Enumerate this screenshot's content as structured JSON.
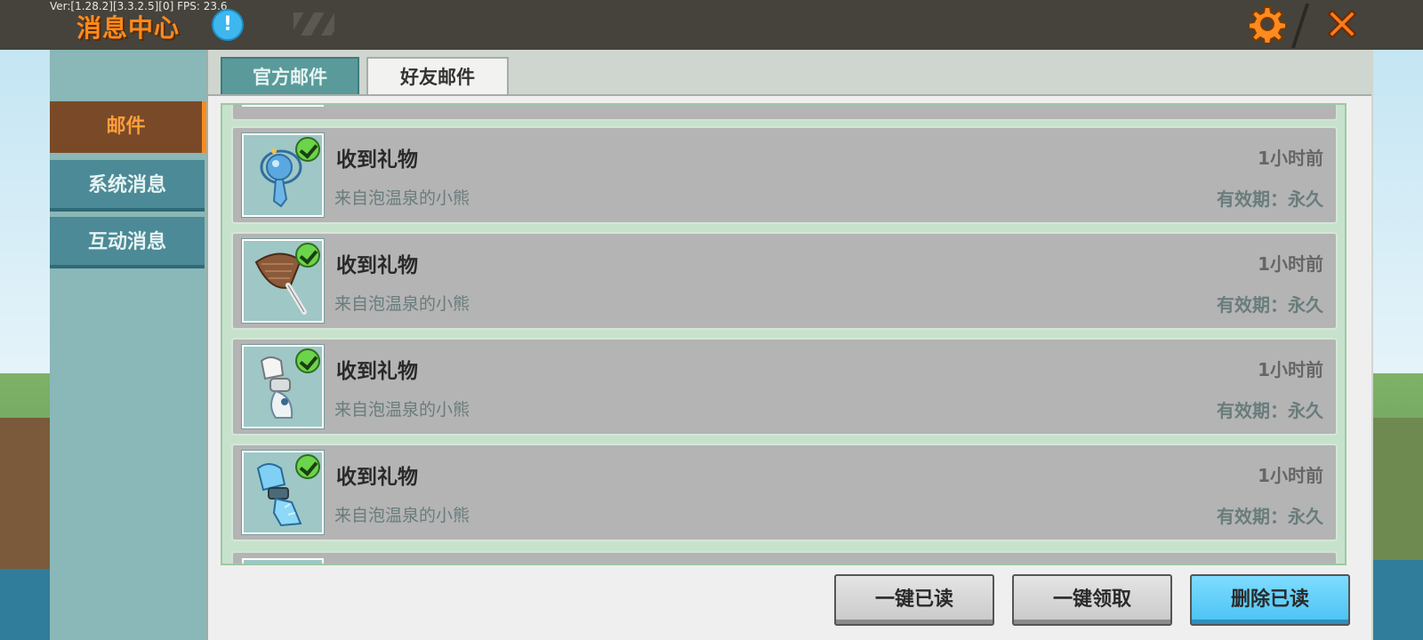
{
  "debug_text": "Ver:[1.28.2][3.3.2.5][0] FPS: 23.6",
  "header": {
    "title": "消息中心",
    "info_icon_glyph": "!",
    "icons": [
      "info-icon",
      "gear-icon",
      "close-icon"
    ],
    "accent": "#ff8a1e"
  },
  "sidebar": {
    "items": [
      {
        "label": "邮件",
        "active": true
      },
      {
        "label": "系统消息",
        "active": false
      },
      {
        "label": "互动消息",
        "active": false
      }
    ]
  },
  "tabs": [
    {
      "label": "官方邮件",
      "active": false
    },
    {
      "label": "好友邮件",
      "active": true
    }
  ],
  "mails": [
    {
      "title": "收到礼物",
      "from": "来自泡温泉的小熊",
      "time": "1小时前",
      "validity": "有效期：永久",
      "item_icon": "blue-orb-staff-icon",
      "claimed": true
    },
    {
      "title": "收到礼物",
      "from": "来自泡温泉的小熊",
      "time": "1小时前",
      "validity": "有效期：永久",
      "item_icon": "leaf-fan-icon",
      "claimed": true
    },
    {
      "title": "收到礼物",
      "from": "来自泡温泉的小熊",
      "time": "1小时前",
      "validity": "有效期：永久",
      "item_icon": "white-glove-icon",
      "claimed": true
    },
    {
      "title": "收到礼物",
      "from": "来自泡温泉的小熊",
      "time": "1小时前",
      "validity": "有效期：永久",
      "item_icon": "ice-gauntlet-icon",
      "claimed": true
    }
  ],
  "actions": {
    "mark_read": "一键已读",
    "claim_all": "一键领取",
    "delete_read": "删除已读"
  }
}
